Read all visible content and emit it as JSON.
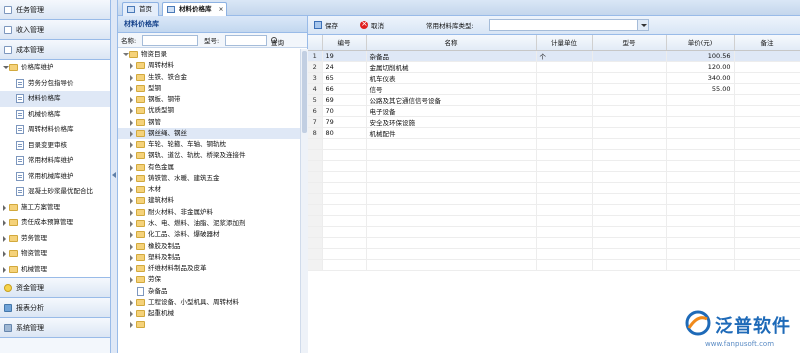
{
  "nav": {
    "sections": [
      {
        "label": "任务管理",
        "icon": "task-icon"
      },
      {
        "label": "收入管理",
        "icon": "income-icon"
      },
      {
        "label": "成本管理",
        "icon": "cost-icon"
      }
    ],
    "tree": [
      {
        "label": "价格库维护",
        "level": 0,
        "type": "folder-open"
      },
      {
        "label": "劳务分包指导价",
        "level": 1,
        "type": "page"
      },
      {
        "label": "材料价格库",
        "level": 1,
        "type": "page",
        "selected": true
      },
      {
        "label": "机械价格库",
        "level": 1,
        "type": "page"
      },
      {
        "label": "周转材料价格库",
        "level": 1,
        "type": "page"
      },
      {
        "label": "目录变更审核",
        "level": 1,
        "type": "page"
      },
      {
        "label": "常用材料库维护",
        "level": 1,
        "type": "page"
      },
      {
        "label": "常用机械库维护",
        "level": 1,
        "type": "page"
      },
      {
        "label": "混凝土砂浆最优配合比",
        "level": 1,
        "type": "page"
      },
      {
        "label": "施工方案管理",
        "level": 0,
        "type": "folder"
      },
      {
        "label": "责任成本预算管理",
        "level": 0,
        "type": "folder"
      },
      {
        "label": "劳务管理",
        "level": 0,
        "type": "folder"
      },
      {
        "label": "物资管理",
        "level": 0,
        "type": "folder"
      },
      {
        "label": "机械管理",
        "level": 0,
        "type": "folder"
      }
    ],
    "bottom_sections": [
      {
        "label": "资金管理",
        "icon": "money-icon"
      },
      {
        "label": "报表分析",
        "icon": "report-icon"
      },
      {
        "label": "系统管理",
        "icon": "settings-icon"
      }
    ]
  },
  "tabs": [
    {
      "label": "首页",
      "active": false
    },
    {
      "label": "材料价格库",
      "active": true
    }
  ],
  "left_panel": {
    "title": "材料价格库",
    "name_label": "名称:",
    "model_label": "型号:",
    "search_label": "查询",
    "name_value": "",
    "model_value": ""
  },
  "catalog_tree": [
    {
      "label": "物资目录",
      "level": 0,
      "type": "folder-open"
    },
    {
      "label": "周转材料",
      "level": 1,
      "type": "folder"
    },
    {
      "label": "生铁、铁合金",
      "level": 1,
      "type": "folder"
    },
    {
      "label": "型钢",
      "level": 1,
      "type": "folder"
    },
    {
      "label": "钢板、钢带",
      "level": 1,
      "type": "folder"
    },
    {
      "label": "优质型钢",
      "level": 1,
      "type": "folder"
    },
    {
      "label": "钢管",
      "level": 1,
      "type": "folder"
    },
    {
      "label": "钢丝绳、钢丝",
      "level": 1,
      "type": "folder",
      "selected": true
    },
    {
      "label": "车轮、轮箍、车轴、钢轨枕",
      "level": 1,
      "type": "folder"
    },
    {
      "label": "钢轨、道岔、轨枕、桥梁及连接件",
      "level": 1,
      "type": "folder"
    },
    {
      "label": "有色金属",
      "level": 1,
      "type": "folder"
    },
    {
      "label": "铸铁管、水暖、建筑五金",
      "level": 1,
      "type": "folder"
    },
    {
      "label": "木材",
      "level": 1,
      "type": "folder"
    },
    {
      "label": "建筑材料",
      "level": 1,
      "type": "folder"
    },
    {
      "label": "耐火材料、非金属炉料",
      "level": 1,
      "type": "folder"
    },
    {
      "label": "水、电、燃料、油脂、泥浆添加剂",
      "level": 1,
      "type": "folder"
    },
    {
      "label": "化工品、涂料、爆破器材",
      "level": 1,
      "type": "folder"
    },
    {
      "label": "橡胶及制品",
      "level": 1,
      "type": "folder"
    },
    {
      "label": "塑料及制品",
      "level": 1,
      "type": "folder"
    },
    {
      "label": "纤维材料制品及皮革",
      "level": 1,
      "type": "folder"
    },
    {
      "label": "劳保",
      "level": 1,
      "type": "folder"
    },
    {
      "label": "杂备品",
      "level": 1,
      "type": "page"
    },
    {
      "label": "工程设备、小型机具、周转材料",
      "level": 1,
      "type": "folder"
    },
    {
      "label": "起重机械",
      "level": 1,
      "type": "folder"
    },
    {
      "label": "",
      "level": 1,
      "type": "folder"
    }
  ],
  "toolbar": {
    "save_label": "保存",
    "cancel_label": "取消",
    "type_label": "常用材料库类型:",
    "type_value": ""
  },
  "grid": {
    "columns": [
      "",
      "编号",
      "名称",
      "计量单位",
      "型号",
      "单价(元)",
      "备注"
    ],
    "rows": [
      {
        "rn": "1",
        "code": "19",
        "name": "杂备品",
        "unit": "个",
        "model": "",
        "price": "100.56",
        "note": ""
      },
      {
        "rn": "2",
        "code": "24",
        "name": "金属切削机械",
        "unit": "",
        "model": "",
        "price": "120.00",
        "note": ""
      },
      {
        "rn": "3",
        "code": "65",
        "name": "机车仪表",
        "unit": "",
        "model": "",
        "price": "340.00",
        "note": ""
      },
      {
        "rn": "4",
        "code": "66",
        "name": "信号",
        "unit": "",
        "model": "",
        "price": "55.00",
        "note": ""
      },
      {
        "rn": "5",
        "code": "69",
        "name": "公路及其它通信信号设备",
        "unit": "",
        "model": "",
        "price": "",
        "note": ""
      },
      {
        "rn": "6",
        "code": "70",
        "name": "电子设备",
        "unit": "",
        "model": "",
        "price": "",
        "note": ""
      },
      {
        "rn": "7",
        "code": "79",
        "name": "安全及环保设施",
        "unit": "",
        "model": "",
        "price": "",
        "note": ""
      },
      {
        "rn": "8",
        "code": "80",
        "name": "机械配件",
        "unit": "",
        "model": "",
        "price": "",
        "note": ""
      }
    ]
  },
  "logo": {
    "text": "泛普软件",
    "url": "www.fanpusoft.com",
    "colors": {
      "blue": "#1e6ab8",
      "orange": "#f08a1c"
    }
  },
  "colors": {
    "panel_border": "#99bbe8",
    "header_text": "#15428b",
    "selected_row": "#dfe8f6"
  }
}
